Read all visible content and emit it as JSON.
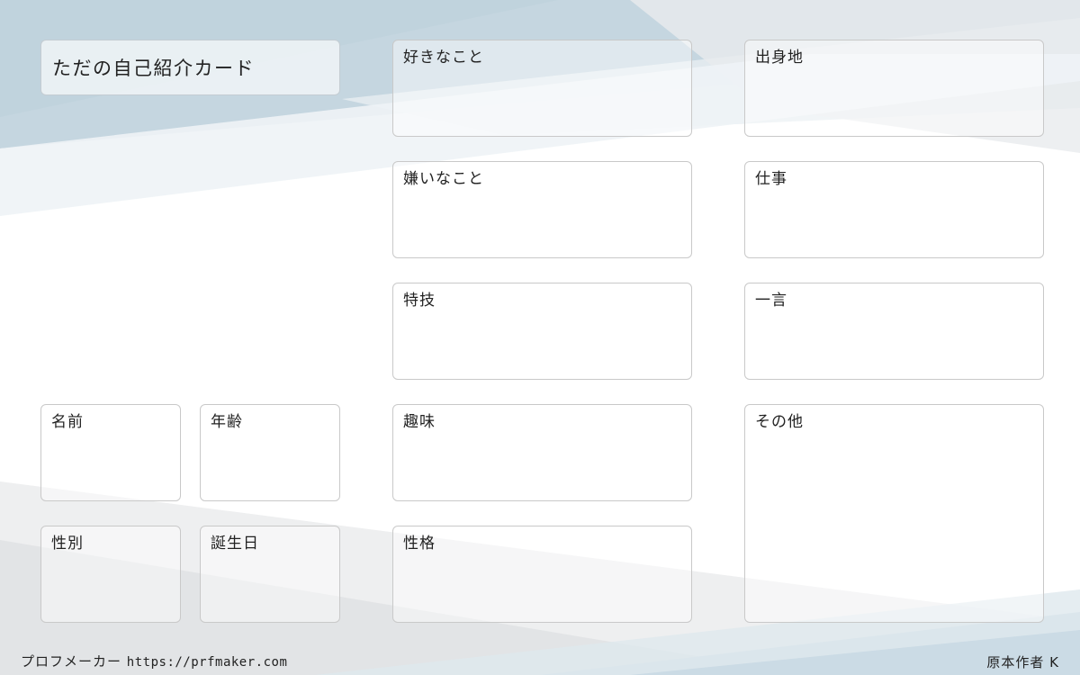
{
  "card": {
    "title": "ただの自己紹介カード",
    "fields": {
      "likes": "好きなこと",
      "birthplace": "出身地",
      "dislikes": "嫌いなこと",
      "job": "仕事",
      "special_skill": "特技",
      "one_word": "一言",
      "name": "名前",
      "age": "年齢",
      "hobby": "趣味",
      "other": "その他",
      "gender": "性別",
      "birthday": "誕生日",
      "personality": "性格"
    }
  },
  "footer": {
    "brand": "プロフメーカー",
    "url": "https://prfmaker.com",
    "author": "原本作者 K"
  },
  "colors": {
    "accent_light": "#c8d8e2",
    "accent_mid": "#b9cfdb",
    "gray_band": "#e6e8ea",
    "box_border": "#c9c9c9"
  }
}
